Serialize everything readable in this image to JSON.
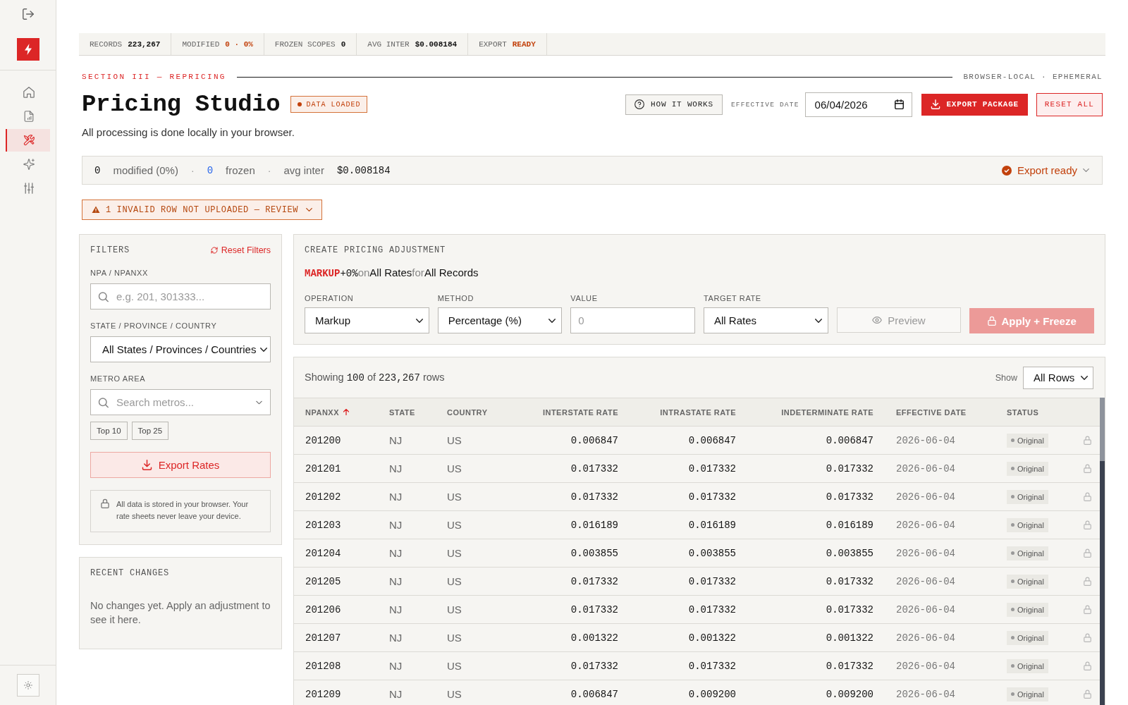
{
  "sidebar": {
    "nav": [
      {
        "kind": "home",
        "selected": false
      },
      {
        "kind": "document",
        "selected": false
      },
      {
        "kind": "tools",
        "selected": true
      },
      {
        "kind": "sparkles",
        "selected": false
      },
      {
        "kind": "sliders",
        "selected": false
      }
    ]
  },
  "stats_bar": [
    {
      "label": "RECORDS",
      "value": "223,267",
      "color": "#111111"
    },
    {
      "label": "MODIFIED",
      "value": "0 · 0%",
      "color": "#c2410c"
    },
    {
      "label": "FROZEN SCOPES",
      "value": "0",
      "color": "#111111"
    },
    {
      "label": "AVG INTER",
      "value": "$0.008184",
      "color": "#111111"
    },
    {
      "label": "EXPORT",
      "value": "READY",
      "color": "#c2410c"
    }
  ],
  "section": {
    "eyebrow": "SECTION III — REPRICING",
    "note": "BROWSER-LOCAL · EPHEMERAL"
  },
  "header": {
    "title": "Pricing Studio",
    "badge": "DATA LOADED",
    "subtitle": "All processing is done locally in your browser.",
    "help_button": "HOW IT WORKS",
    "date_label": "EFFECTIVE DATE",
    "date_value": "06/04/2026",
    "export_button": "EXPORT PACKAGE",
    "reset_button": "RESET ALL"
  },
  "summary": {
    "parts": [
      {
        "kind": "count",
        "text": "0",
        "color": "#111111"
      },
      {
        "kind": "label",
        "text": "modified (0%)"
      },
      {
        "kind": "separator",
        "text": "·"
      },
      {
        "kind": "count",
        "text": "0",
        "color": "#2563eb"
      },
      {
        "kind": "label",
        "text": "frozen"
      },
      {
        "kind": "separator",
        "text": "·"
      },
      {
        "kind": "label",
        "text": "avg inter"
      },
      {
        "kind": "amount",
        "text": "$0.008184"
      }
    ],
    "status": "Export ready"
  },
  "alert": {
    "text": "1 INVALID ROW NOT UPLOADED — REVIEW"
  },
  "filters": {
    "title": "FILTERS",
    "reset": "Reset Filters",
    "fields": [
      {
        "kind": "search",
        "label": "NPA / NPANXX",
        "placeholder": "e.g. 201, 301333..."
      },
      {
        "kind": "select",
        "label": "STATE / PROVINCE / COUNTRY",
        "value": "All States / Provinces / Countries"
      },
      {
        "kind": "combo",
        "label": "METRO AREA",
        "placeholder": "Search metros..."
      }
    ],
    "presets": [
      "Top 10",
      "Top 25"
    ],
    "export_button": "Export Rates",
    "privacy_note": "All data is stored in your browser. Your rate sheets never leave your device."
  },
  "recent_changes": {
    "title": "RECENT CHANGES",
    "empty_text": "No changes yet. Apply an adjustment to see it here."
  },
  "adjustment": {
    "title": "CREATE PRICING ADJUSTMENT",
    "summary": [
      {
        "kind": "operation",
        "text": "MARKUP"
      },
      {
        "kind": "amount",
        "text": "+0%"
      },
      {
        "kind": "joiner",
        "text": "on"
      },
      {
        "kind": "term",
        "text": "All Rates"
      },
      {
        "kind": "joiner",
        "text": "for"
      },
      {
        "kind": "term",
        "text": "All Records"
      }
    ],
    "controls": [
      {
        "kind": "select",
        "label": "OPERATION",
        "value": "Markup"
      },
      {
        "kind": "select",
        "label": "METHOD",
        "value": "Percentage (%)"
      },
      {
        "kind": "input",
        "label": "VALUE",
        "placeholder": "0"
      },
      {
        "kind": "select",
        "label": "TARGET RATE",
        "value": "All Rates"
      }
    ],
    "buttons": [
      {
        "kind": "preview",
        "label": "Preview",
        "disabled": true
      },
      {
        "kind": "apply",
        "label": "Apply + Freeze",
        "disabled": true
      }
    ]
  },
  "table": {
    "showing": [
      {
        "kind": "text",
        "text": "Showing"
      },
      {
        "kind": "number",
        "text": "100"
      },
      {
        "kind": "text",
        "text": "of"
      },
      {
        "kind": "number",
        "text": "223,267"
      },
      {
        "kind": "text",
        "text": "rows"
      }
    ],
    "show_label": "Show",
    "show_value": "All Rows",
    "columns": [
      {
        "label": "NPANXX",
        "kind": "code",
        "sorted": true
      },
      {
        "label": "STATE",
        "kind": "text",
        "sorted": false
      },
      {
        "label": "COUNTRY",
        "kind": "text",
        "sorted": false
      },
      {
        "label": "INTERSTATE RATE",
        "kind": "rate",
        "sorted": false
      },
      {
        "label": "INTRASTATE RATE",
        "kind": "rate",
        "sorted": false
      },
      {
        "label": "INDETERMINATE RATE",
        "kind": "rate",
        "sorted": false
      },
      {
        "label": "EFFECTIVE DATE",
        "kind": "date",
        "sorted": false
      },
      {
        "label": "STATUS",
        "kind": "status",
        "sorted": false
      }
    ],
    "rows": [
      {
        "cells": [
          "201200",
          "NJ",
          "US",
          "0.006847",
          "0.006847",
          "0.006847",
          "2026-06-04",
          "Original"
        ],
        "frozen": false
      },
      {
        "cells": [
          "201201",
          "NJ",
          "US",
          "0.017332",
          "0.017332",
          "0.017332",
          "2026-06-04",
          "Original"
        ],
        "frozen": false
      },
      {
        "cells": [
          "201202",
          "NJ",
          "US",
          "0.017332",
          "0.017332",
          "0.017332",
          "2026-06-04",
          "Original"
        ],
        "frozen": false
      },
      {
        "cells": [
          "201203",
          "NJ",
          "US",
          "0.016189",
          "0.016189",
          "0.016189",
          "2026-06-04",
          "Original"
        ],
        "frozen": false
      },
      {
        "cells": [
          "201204",
          "NJ",
          "US",
          "0.003855",
          "0.003855",
          "0.003855",
          "2026-06-04",
          "Original"
        ],
        "frozen": false
      },
      {
        "cells": [
          "201205",
          "NJ",
          "US",
          "0.017332",
          "0.017332",
          "0.017332",
          "2026-06-04",
          "Original"
        ],
        "frozen": false
      },
      {
        "cells": [
          "201206",
          "NJ",
          "US",
          "0.017332",
          "0.017332",
          "0.017332",
          "2026-06-04",
          "Original"
        ],
        "frozen": false
      },
      {
        "cells": [
          "201207",
          "NJ",
          "US",
          "0.001322",
          "0.001322",
          "0.001322",
          "2026-06-04",
          "Original"
        ],
        "frozen": false
      },
      {
        "cells": [
          "201208",
          "NJ",
          "US",
          "0.017332",
          "0.017332",
          "0.017332",
          "2026-06-04",
          "Original"
        ],
        "frozen": false
      },
      {
        "cells": [
          "201209",
          "NJ",
          "US",
          "0.006847",
          "0.009200",
          "0.009200",
          "2026-06-04",
          "Original"
        ],
        "frozen": false
      }
    ]
  }
}
